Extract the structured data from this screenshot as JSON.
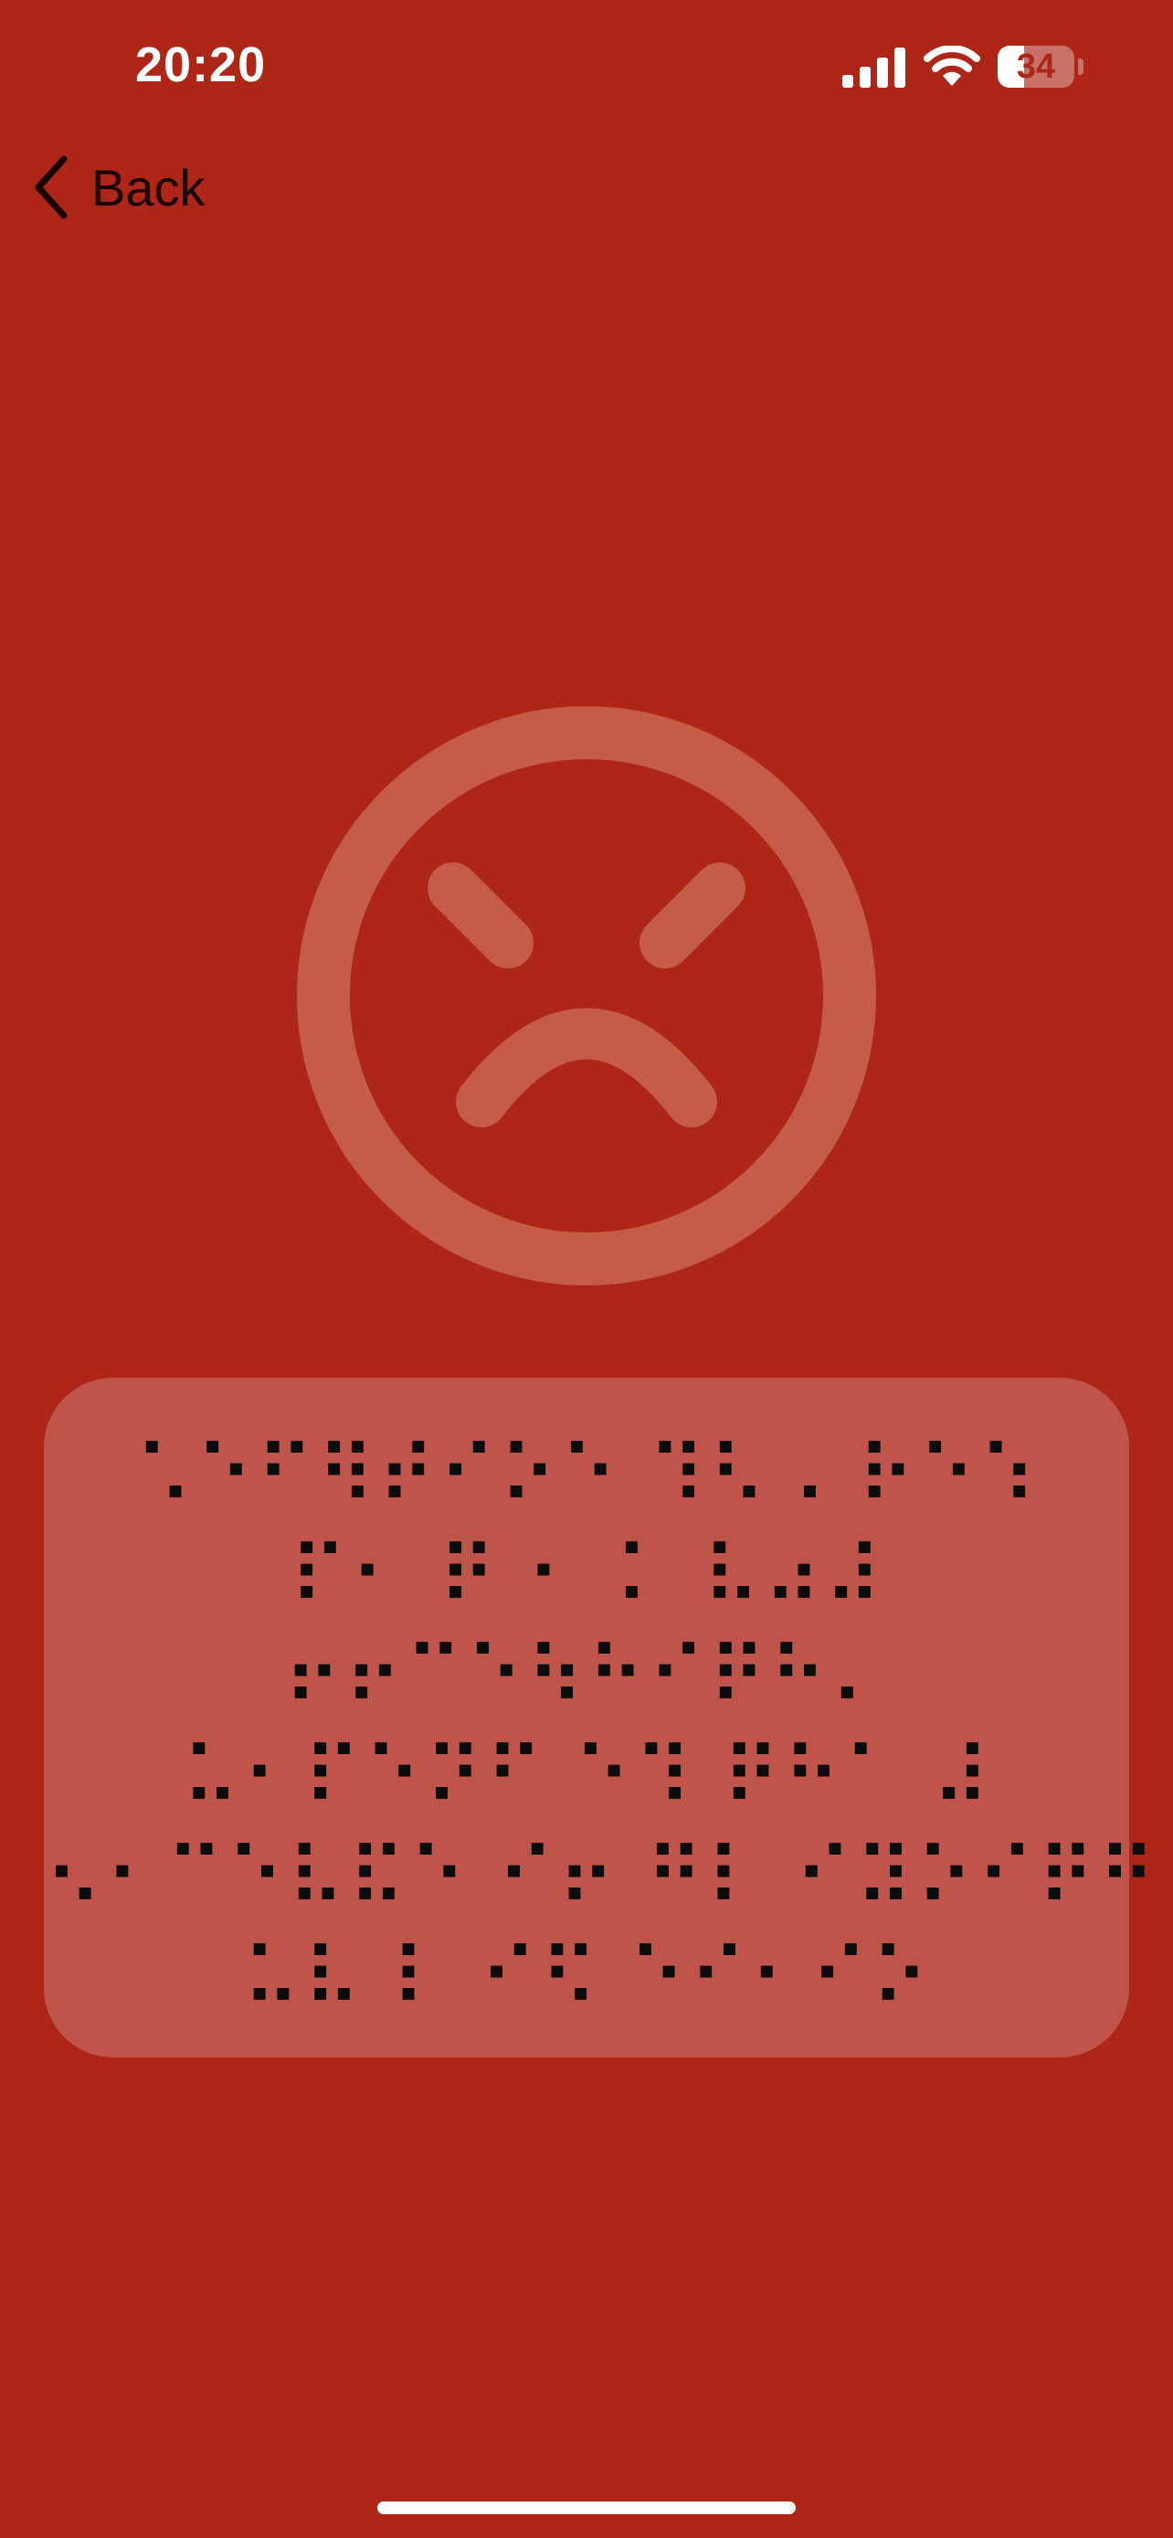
{
  "status_bar": {
    "time": "20:20",
    "battery_level": "34",
    "battery_fraction": 0.34,
    "icons": [
      "signal-icon",
      "wifi-icon",
      "battery-icon"
    ]
  },
  "nav": {
    "back_label": "Back",
    "back_icon": "chevron-left-icon"
  },
  "face": {
    "icon": "angry-face-icon",
    "color": "#c45c47"
  },
  "braille_card": {
    "lines": [
      "⠡⠑⠋⠻⠞⠊⠕⠑ ⠹⠣⠠ ⠗⠑⠱",
      "⠏⠂ ⠟ ⠂ ⠅ ⠧⠴⠼",
      "⠖⠖⠉⠑⠳⠓⠊⠟⠓⠄",
      "⠥⠂⠏⠑⠝⠋ ⠑⠹ ⠟⠓⠁ ⠼",
      "⠢⠂⠉⠑⠧⠯⠑ ⠊⠖ ⠛⠇ ⠊⠽⠕⠊⠟⠛",
      "⠥⠧ ⠇ ⠊⠫ ⠑⠊⠂⠊⠕"
    ]
  },
  "colors": {
    "background": "#ad2618",
    "card": "#c45c47",
    "braille_dots": "#0b0b0b"
  }
}
